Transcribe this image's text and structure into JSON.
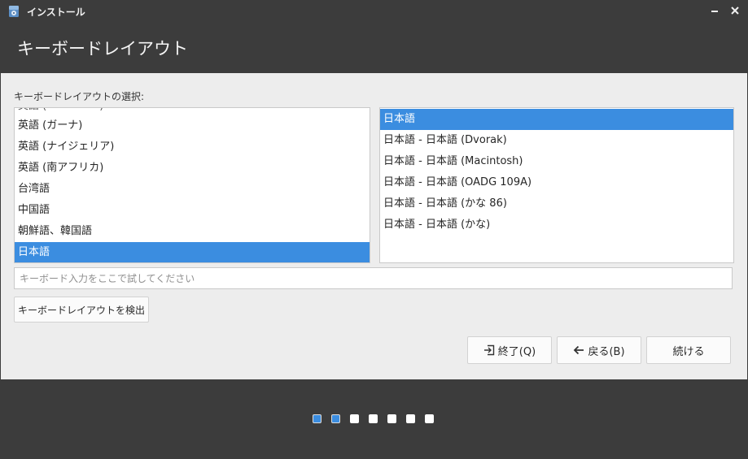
{
  "window": {
    "title": "インストール"
  },
  "header": {
    "title": "キーボードレイアウト"
  },
  "layout_section": {
    "label": "キーボードレイアウトの選択:"
  },
  "layouts": [
    {
      "label": "英語 (ガーナ)",
      "selected": false
    },
    {
      "label": "英語 (ナイジェリア)",
      "selected": false
    },
    {
      "label": "英語 (南アフリカ)",
      "selected": false
    },
    {
      "label": "台湾語",
      "selected": false
    },
    {
      "label": "中国語",
      "selected": false
    },
    {
      "label": "朝鮮語、韓国語",
      "selected": false
    },
    {
      "label": "日本語",
      "selected": true
    }
  ],
  "variants": [
    {
      "label": "日本語",
      "selected": true
    },
    {
      "label": "日本語 - 日本語 (Dvorak)",
      "selected": false
    },
    {
      "label": "日本語 - 日本語 (Macintosh)",
      "selected": false
    },
    {
      "label": "日本語 - 日本語 (OADG 109A)",
      "selected": false
    },
    {
      "label": "日本語 - 日本語 (かな 86)",
      "selected": false
    },
    {
      "label": "日本語 - 日本語 (かな)",
      "selected": false
    }
  ],
  "test_input": {
    "placeholder": "キーボード入力をここで試してください",
    "value": ""
  },
  "buttons": {
    "detect": "キーボードレイアウトを検出",
    "quit": "終了(Q)",
    "back": "戻る(B)",
    "next": "続ける"
  },
  "progress": {
    "total_steps": 7,
    "completed_steps": 2
  },
  "colors": {
    "accent": "#3b8de0",
    "chrome": "#3c3c3c",
    "panel": "#ededed"
  },
  "icons": {
    "app": "installer-disk-icon",
    "minimize": "minimize-icon",
    "close": "close-icon",
    "quit": "exit-icon",
    "back": "arrow-left-icon"
  }
}
